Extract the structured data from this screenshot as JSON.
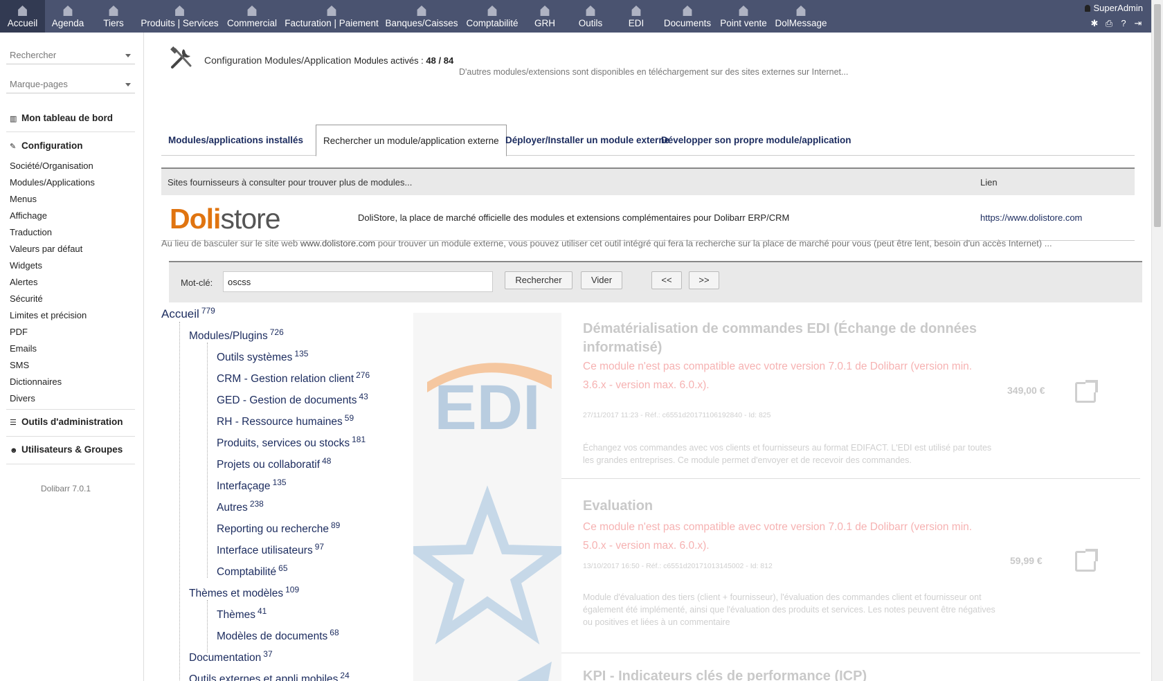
{
  "topnav": {
    "items": [
      {
        "label": "Accueil",
        "icon": "home-icon"
      },
      {
        "label": "Agenda",
        "icon": "agenda-icon"
      },
      {
        "label": "Tiers",
        "icon": "company-icon"
      },
      {
        "label": "Produits | Services",
        "icon": "products-icon"
      },
      {
        "label": "Commercial",
        "icon": "commercial-icon"
      },
      {
        "label": "Facturation | Paiement",
        "icon": "billing-icon"
      },
      {
        "label": "Banques/Caisses",
        "icon": "bank-icon"
      },
      {
        "label": "Comptabilité",
        "icon": "accounting-icon"
      },
      {
        "label": "GRH",
        "icon": "hrm-icon"
      },
      {
        "label": "Outils",
        "icon": "tools-icon"
      },
      {
        "label": "EDI",
        "icon": "edi-icon"
      },
      {
        "label": "Documents",
        "icon": "documents-icon"
      },
      {
        "label": "Point vente",
        "icon": "pos-icon"
      },
      {
        "label": "DolMessage",
        "icon": "dolmessage-icon"
      }
    ],
    "user": "SuperAdmin"
  },
  "sidebar": {
    "search_placeholder": "Rechercher",
    "bookmarks_placeholder": "Marque-pages",
    "dashboard": "Mon tableau de bord",
    "config": "Configuration",
    "config_items": [
      "Société/Organisation",
      "Modules/Applications",
      "Menus",
      "Affichage",
      "Traduction",
      "Valeurs par défaut",
      "Widgets",
      "Alertes",
      "Sécurité",
      "Limites et précision",
      "PDF",
      "Emails",
      "SMS",
      "Dictionnaires",
      "Divers"
    ],
    "admin_tools": "Outils d'administration",
    "users_groups": "Utilisateurs & Groupes",
    "version": "Dolibarr 7.0.1"
  },
  "header": {
    "title": "Configuration Modules/Application",
    "modules_label": "Modules activés :",
    "modules_count": "48 / 84",
    "subtitle": "D'autres modules/extensions sont disponibles en téléchargement sur des sites externes sur Internet..."
  },
  "tabs": [
    "Modules/applications installés",
    "Rechercher un module/application externe",
    "Déployer/Installer un module externe",
    "Développer son propre module/application"
  ],
  "sites": {
    "col_sites": "Sites fournisseurs à consulter pour trouver plus de modules...",
    "col_link": "Lien",
    "logo_bold": "Doli",
    "logo_rest": "store",
    "description": "DoliStore, la place de marché officielle des modules et extensions complémentaires pour Dolibarr ERP/CRM",
    "url": "https://www.dolistore.com"
  },
  "info": {
    "prefix": "Au lieu de basculer sur le site web ",
    "link": "www.dolistore.com",
    "suffix": " pour trouver un module externe, vous pouvez utiliser cet outil intégré qui fera la recherche sur la place de marché pour vous (peut être lent, besoin d'un accès Internet) ..."
  },
  "search": {
    "label": "Mot-clé:",
    "value": "oscss",
    "btn_search": "Rechercher",
    "btn_clear": "Vider",
    "btn_prev": "<<",
    "btn_next": ">>"
  },
  "tree": {
    "root": {
      "label": "Accueil",
      "count": "779"
    },
    "modules": {
      "label": "Modules/Plugins",
      "count": "726"
    },
    "module_children": [
      {
        "label": "Outils systèmes",
        "count": "135"
      },
      {
        "label": "CRM - Gestion relation client",
        "count": "276"
      },
      {
        "label": "GED - Gestion de documents",
        "count": "43"
      },
      {
        "label": "RH - Ressource humaines",
        "count": "59"
      },
      {
        "label": "Produits, services ou stocks",
        "count": "181"
      },
      {
        "label": "Projets ou collaboratif",
        "count": "48"
      },
      {
        "label": "Interfaçage",
        "count": "135"
      },
      {
        "label": "Autres",
        "count": "238"
      },
      {
        "label": "Reporting ou recherche",
        "count": "89"
      },
      {
        "label": "Interface utilisateurs",
        "count": "97"
      },
      {
        "label": "Comptabilité",
        "count": "65"
      }
    ],
    "themes": {
      "label": "Thèmes et modèles",
      "count": "109"
    },
    "theme_children": [
      {
        "label": "Thèmes",
        "count": "41"
      },
      {
        "label": "Modèles de documents",
        "count": "68"
      }
    ],
    "documentation": {
      "label": "Documentation",
      "count": "37"
    },
    "external": {
      "label": "Outils externes et appli mobiles",
      "count": "24"
    }
  },
  "products": [
    {
      "title": "Dématérialisation de commandes EDI (Échange de données informatisé)",
      "warning": "Ce module n'est pas compatible avec votre version 7.0.1 de Dolibarr (version min. 3.6.x - version max. 6.0.x).",
      "meta": "27/11/2017 11:23 - Réf.: c6551d20171106192840 - Id: 825",
      "description": "Échangez vos commandes avec vos clients et fournisseurs au format EDIFACT. L'EDI est utilisé par toutes les grandes entreprises. Ce module permet d'envoyer et de recevoir des commandes.",
      "price": "349,00 €",
      "image_text": "EDI"
    },
    {
      "title": "Evaluation",
      "warning": "Ce module n'est pas compatible avec votre version 7.0.1 de Dolibarr (version min. 5.0.x - version max. 6.0.x).",
      "meta": "13/10/2017 16:50 - Réf.: c6551d20171013145002 - Id: 812",
      "description": "Module d'évaluation des tiers (client + fournisseur), l'évaluation des commandes client et fournisseur ont également été implémenté, ainsi que l'évaluation des produits et services. Les notes peuvent être négatives ou positives et liées à un commentaire",
      "price": "59,99 €"
    },
    {
      "title": "KPI - Indicateurs clés de performance (ICP)"
    }
  ],
  "colors": {
    "nav": "#4a5370",
    "nav_active": "#323a52",
    "link": "#1b2b5e",
    "accent": "#e07410"
  }
}
